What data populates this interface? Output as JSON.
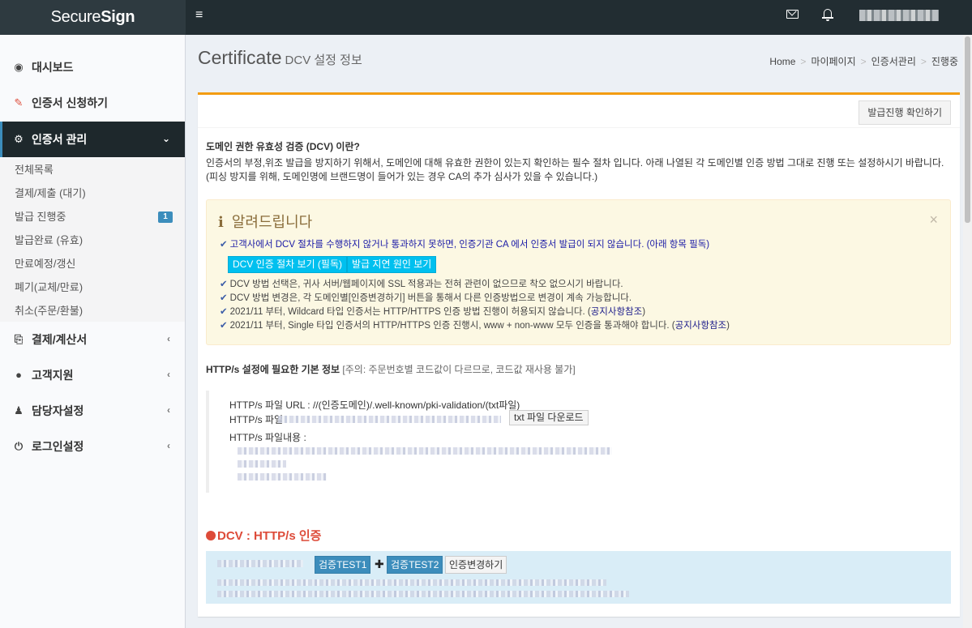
{
  "brand": {
    "part1": "Secure",
    "part2": "Sign"
  },
  "topbar": {
    "menu_glyph": "≡"
  },
  "sidebar": {
    "items": [
      {
        "label": "대시보드",
        "icon": "tachometer-icon",
        "glyph": "◉"
      },
      {
        "label": "인증서 신청하기",
        "icon": "edit-icon",
        "glyph": "✎"
      },
      {
        "label": "인증서 관리",
        "icon": "cogs-icon",
        "glyph": "⚙"
      },
      {
        "label": "결제/계산서",
        "icon": "receipt-icon",
        "glyph": "⎘"
      },
      {
        "label": "고객지원",
        "icon": "comments-icon",
        "glyph": "●"
      },
      {
        "label": "담당자설정",
        "icon": "users-icon",
        "glyph": "♟"
      },
      {
        "label": "로그인설정",
        "icon": "power-icon",
        "glyph": "⏻"
      }
    ],
    "sub": [
      "전체목록",
      "결제/제출 (대기)",
      "발급 진행중",
      "발급완료 (유효)",
      "만료예정/갱신",
      "폐기(교체/만료)",
      "취소(주문/환불)"
    ],
    "badge": "1",
    "chevron_down": "⌄",
    "chevron_left": "‹"
  },
  "header": {
    "title": "Certificate",
    "subtitle": "DCV 설정 정보"
  },
  "breadcrumb": [
    "Home",
    "마이페이지",
    "인증서관리",
    "진행중"
  ],
  "breadcrumb_sep": ">",
  "content": {
    "confirm_button": "발급진행 확인하기",
    "dcv_heading": "도메인 권한 유효성 검증 (DCV) 이란?",
    "dcv_desc": "인증서의 부정,위조 발급을 방지하기 위해서, 도메인에 대해 유효한 권한이 있는지 확인하는 필수 절차 입니다. 아래 나열된 각 도메인별 인증 방법 그대로 진행 또는 설정하시기 바랍니다. (피싱 방지를 위해, 도메인명에 브랜드명이 들어가 있는 경우 CA의 추가 심사가 있을 수 있습니다.)",
    "alert": {
      "icon": "i",
      "title": "알려드립니다",
      "close": "×",
      "check": "✔",
      "line1": "고객사에서 DCV 절차를 수행하지 않거나 통과하지 못하면, 인증기관 CA 에서 인증서 발급이 되지 않습니다. (아래 항목 필독)",
      "btn1": "DCV 인증 절차 보기 (필독)",
      "btn2": "발급 지연 원인 보기",
      "line2": "DCV 방법 선택은, 귀사 서버/웹페이지에 SSL 적용과는 전혀 관련이 없으므로 착오 없으시기 바랍니다.",
      "line3": "DCV 방법 변경은, 각 도메인별[인증변경하기] 버튼을 통해서 다른 인증방법으로 변경이 계속 가능합니다.",
      "line4_pre": "2021/11 부터, Wildcard 타입 인증서는 HTTP/HTTPS 인증 방법 진행이 허용되지 않습니다. (",
      "line4_link": "공지사항참조",
      "line4_post": ")",
      "line5_pre": "2021/11 부터, Single 타입 인증서의 HTTP/HTTPS 인증 진행시, www + non-www 모두 인증을 통과해야 합니다. (",
      "line5_link": "공지사항참조",
      "line5_post": ")"
    },
    "http_title": "HTTP/s 설정에 필요한 기본 정보",
    "http_note": "[주의: 주문번호별 코드값이 다르므로, 코드값 재사용 불가]",
    "file_url": "HTTP/s 파일 URL : //(인증도메인)/.well-known/pki-validation/(txt파일)",
    "file_label": "HTTP/s 파일",
    "download_btn": "txt 파일 다운로드",
    "file_content": "HTTP/s 파일내용 :",
    "dcv_title": "DCV : HTTP/s 인증",
    "test1": "검증TEST1",
    "plus": "✚",
    "test2": "검증TEST2",
    "change": "인증변경하기"
  }
}
